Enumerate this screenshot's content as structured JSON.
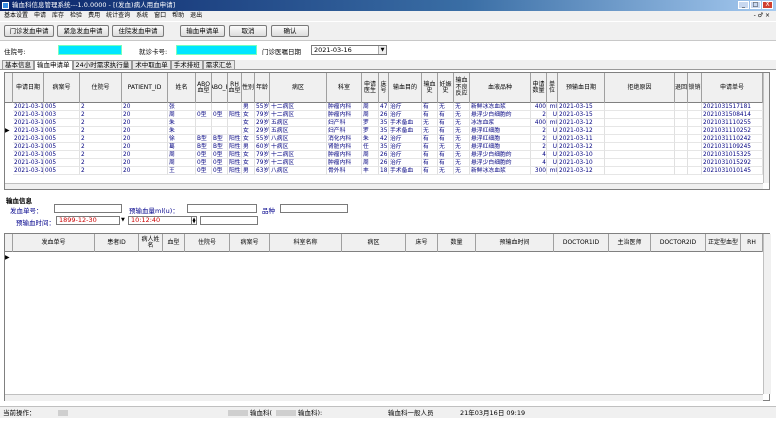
{
  "window": {
    "title": "输血科信息管理系统---1.0.0000 - [(发血)病人用血申请]",
    "min": "_",
    "max": "□",
    "close": "X"
  },
  "menu": {
    "items": [
      "基本设置",
      "申请",
      "库存",
      "检验",
      "费用",
      "统计查询",
      "系统",
      "窗口",
      "帮助",
      "退出"
    ],
    "mdi": "- ♂ ×"
  },
  "toolbar": {
    "buttons": [
      "门诊发血申请",
      "紧急发血申请",
      "住院发血申请",
      "输血申请单",
      "取消",
      "确认"
    ]
  },
  "search": {
    "inpatient_label": "住院号:",
    "visit_label": "就诊卡号:",
    "date_label": "门诊医嘱日期",
    "date_value": "2021-03-16"
  },
  "tabs": [
    "基本信息",
    "输血申请单",
    "24小时需求执行量",
    "术中取血单",
    "手术排班",
    "需求汇总"
  ],
  "table1": {
    "headers": [
      "申请日期",
      "病案号",
      "住院号",
      "PATIENT_ID",
      "姓名",
      "ABO血型",
      "RH\n血型",
      "年龄",
      "病区",
      "科室",
      "申请医生",
      "床号",
      "输血目的",
      "输血史",
      "妊娠史",
      "输血不良反应",
      "血液品种",
      "申请数量",
      "单位",
      "预输血日期",
      "拒绝原因",
      "退回",
      "锁销",
      "申请单号"
    ],
    "rows": [
      {
        "date": "2021-03-15",
        "case": "005",
        "zyh": "2",
        "pid": "20",
        "name": "张",
        "abo": "",
        "rh": "",
        "sex": "男",
        "age": "55岁",
        "ward": "十二病区",
        "dept": "肿瘤内科",
        "doc": "周",
        "bed": "47",
        "purpose": "治疗",
        "hist": "有",
        "preg": "无",
        "react": "无",
        "blood": "新鲜冰冻血浆",
        "qty": "400",
        "unit": "ml",
        "pre": "2021-03-15",
        "apply": "2021031517181"
      },
      {
        "date": "2021-03-15",
        "case": "003",
        "zyh": "2",
        "pid": "20",
        "name": "周",
        "abo": "0型",
        "rh": "阳性",
        "sex": "女",
        "age": "79岁",
        "ward": "十二病区",
        "dept": "肿瘤内科",
        "doc": "周",
        "bed": "26",
        "purpose": "治疗",
        "hist": "有",
        "preg": "有",
        "react": "无",
        "blood": "悬浮少白细胞的",
        "qty": "2",
        "unit": "U",
        "pre": "2021-03-15",
        "apply": "2021031508414"
      },
      {
        "date": "2021-03-11",
        "case": "005",
        "zyh": "2",
        "pid": "20",
        "name": "朱",
        "abo": "",
        "rh": "",
        "sex": "女",
        "age": "29岁",
        "ward": "五病区",
        "dept": "妇产科",
        "doc": "罗",
        "bed": "35",
        "purpose": "手术备血",
        "hist": "无",
        "preg": "有",
        "react": "无",
        "blood": "冰冻血浆",
        "qty": "400",
        "unit": "ml",
        "pre": "2021-03-12",
        "apply": "2021031110255"
      },
      {
        "date": "2021-03-11",
        "case": "005",
        "zyh": "2",
        "pid": "20",
        "name": "朱",
        "abo": "",
        "rh": "",
        "sex": "女",
        "age": "29岁",
        "ward": "五病区",
        "dept": "妇产科",
        "doc": "罗",
        "bed": "35",
        "purpose": "手术备血",
        "hist": "无",
        "preg": "有",
        "react": "无",
        "blood": "悬浮红细胞",
        "qty": "2",
        "unit": "U",
        "pre": "2021-03-12",
        "apply": "2021031110252"
      },
      {
        "date": "2021-03-11",
        "case": "005",
        "zyh": "2",
        "pid": "20",
        "name": "徐",
        "abo": "B型",
        "rh": "阳性",
        "sex": "女",
        "age": "55岁",
        "ward": "八病区",
        "dept": "消化内科",
        "doc": "朱",
        "bed": "42",
        "purpose": "治疗",
        "hist": "有",
        "preg": "有",
        "react": "无",
        "blood": "悬浮红细胞",
        "qty": "2",
        "unit": "U",
        "pre": "2021-03-11",
        "apply": "2021031110242"
      },
      {
        "date": "2021-03-11",
        "case": "005",
        "zyh": "2",
        "pid": "20",
        "name": "葛",
        "abo": "B型",
        "rh": "阳性",
        "sex": "男",
        "age": "60岁",
        "ward": "十病区",
        "dept": "肾脏内科",
        "doc": "任",
        "bed": "35",
        "purpose": "治疗",
        "hist": "有",
        "preg": "无",
        "react": "无",
        "blood": "悬浮红细胞",
        "qty": "2",
        "unit": "U",
        "pre": "2021-03-12",
        "apply": "2021031109245"
      },
      {
        "date": "2021-03-10",
        "case": "005",
        "zyh": "2",
        "pid": "20",
        "name": "周",
        "abo": "0型",
        "rh": "阳性",
        "sex": "女",
        "age": "79岁",
        "ward": "十二病区",
        "dept": "肿瘤内科",
        "doc": "周",
        "bed": "26",
        "purpose": "治疗",
        "hist": "有",
        "preg": "有",
        "react": "无",
        "blood": "悬浮少白细胞的",
        "qty": "4",
        "unit": "U",
        "pre": "2021-03-10",
        "apply": "2021031015325"
      },
      {
        "date": "2021-03-10",
        "case": "005",
        "zyh": "2",
        "pid": "20",
        "name": "周",
        "abo": "0型",
        "rh": "阳性",
        "sex": "女",
        "age": "79岁",
        "ward": "十二病区",
        "dept": "肿瘤内科",
        "doc": "周",
        "bed": "26",
        "purpose": "治疗",
        "hist": "有",
        "preg": "有",
        "react": "无",
        "blood": "悬浮少白细胞的",
        "qty": "4",
        "unit": "U",
        "pre": "2021-03-10",
        "apply": "2021031015292"
      },
      {
        "date": "2021-03-10",
        "case": "005",
        "zyh": "2",
        "pid": "20",
        "name": "王",
        "abo": "0型",
        "rh": "阳性",
        "sex": "男",
        "age": "63岁",
        "ward": "八病区",
        "dept": "骨外科",
        "doc": "丰",
        "bed": "18",
        "purpose": "手术备血",
        "hist": "有",
        "preg": "无",
        "react": "无",
        "blood": "新鲜冰冻血浆",
        "qty": "300",
        "unit": "ml",
        "pre": "2021-03-12",
        "apply": "2021031010145"
      }
    ]
  },
  "info": {
    "title": "输血信息",
    "bill_label": "发血单号：",
    "qty_label": "预输血量ml(u)：",
    "kind_label": "品种",
    "time_label": "预输血时间：",
    "time_value": "1899-12-30",
    "clock": "10:12:40"
  },
  "table2": {
    "headers": [
      "发血单号",
      "患者ID",
      "病人姓名",
      "血型",
      "住院号",
      "病案号",
      "科室名称",
      "病区",
      "床号",
      "数量",
      "预输血时间",
      "DOCTOR1ID",
      "主治医师",
      "DOCTOR2ID",
      "正定型血型",
      "RH"
    ]
  },
  "status": {
    "op_label": "当前操作：",
    "dept1": "输血科(",
    "dept2": "输血科):",
    "role": "输血科一般人员",
    "time": "21年03月16日 09:19"
  }
}
